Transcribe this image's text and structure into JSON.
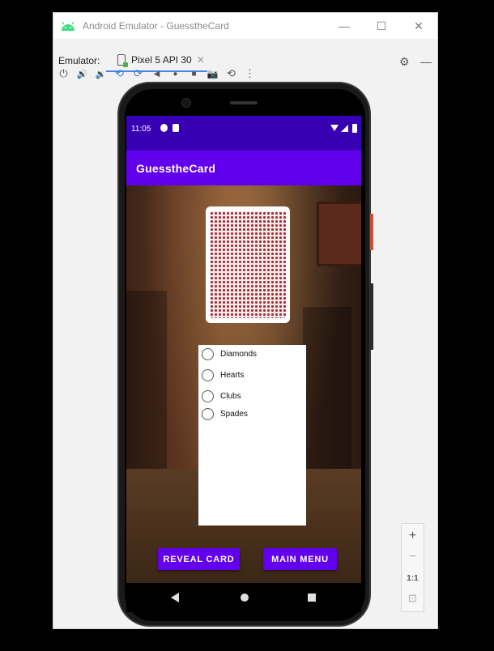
{
  "window": {
    "title": "Android Emulator - GuesstheCard",
    "minimize_glyph": "—",
    "maximize_glyph": "☐",
    "close_glyph": "✕"
  },
  "tabbar": {
    "emulator_label": "Emulator:",
    "device_tab_label": "Pixel 5 API 30",
    "tab_close_glyph": "✕",
    "settings_glyph": "⚙",
    "hide_glyph": "—"
  },
  "toolbar": {
    "icons": [
      "power-icon",
      "volume-up-icon",
      "volume-down-icon",
      "rotate-left-icon",
      "rotate-right-icon",
      "back-icon",
      "home-icon",
      "overview-icon",
      "camera-icon",
      "snapshot-icon",
      "more-icon"
    ],
    "glyphs": [
      "⏻",
      "🔊",
      "🔉",
      "⟲",
      "⟳",
      "◀",
      "●",
      "■",
      "📷",
      "⟲",
      "⋮"
    ]
  },
  "phone": {
    "status": {
      "time": "11:05"
    },
    "app_title": "GuesstheCard",
    "radio_options": [
      "Diamonds",
      "Hearts",
      "Clubs",
      "Spades"
    ],
    "reveal_button": "REVEAL CARD",
    "menu_button": "MAIN MENU"
  },
  "zoom": {
    "zoom_in": "+",
    "zoom_out": "−",
    "one_to_one": "1:1",
    "fit_glyph": "⊡"
  },
  "colors": {
    "status_bar": "#3700b3",
    "app_bar": "#6200ee",
    "button": "#6200ee",
    "card_back": "#a03038"
  }
}
